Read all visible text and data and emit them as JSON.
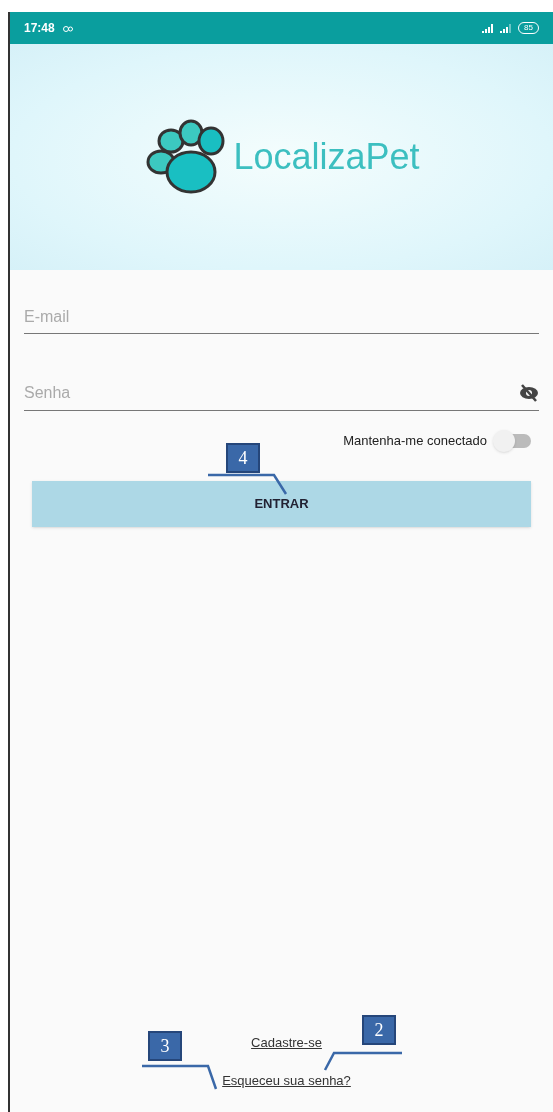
{
  "status_bar": {
    "time": "17:48",
    "battery": "85"
  },
  "header": {
    "app_name": "LocalizaPet"
  },
  "form": {
    "email": {
      "placeholder": "E-mail"
    },
    "password": {
      "placeholder": "Senha"
    },
    "keep_connected": {
      "label": "Mantenha-me conectado",
      "on": false
    },
    "submit": "ENTRAR"
  },
  "links": [
    "Cadastre-se",
    "Esqueceu sua senha?"
  ],
  "callouts": [
    {
      "number": "4"
    },
    {
      "number": "2"
    },
    {
      "number": "3"
    }
  ]
}
